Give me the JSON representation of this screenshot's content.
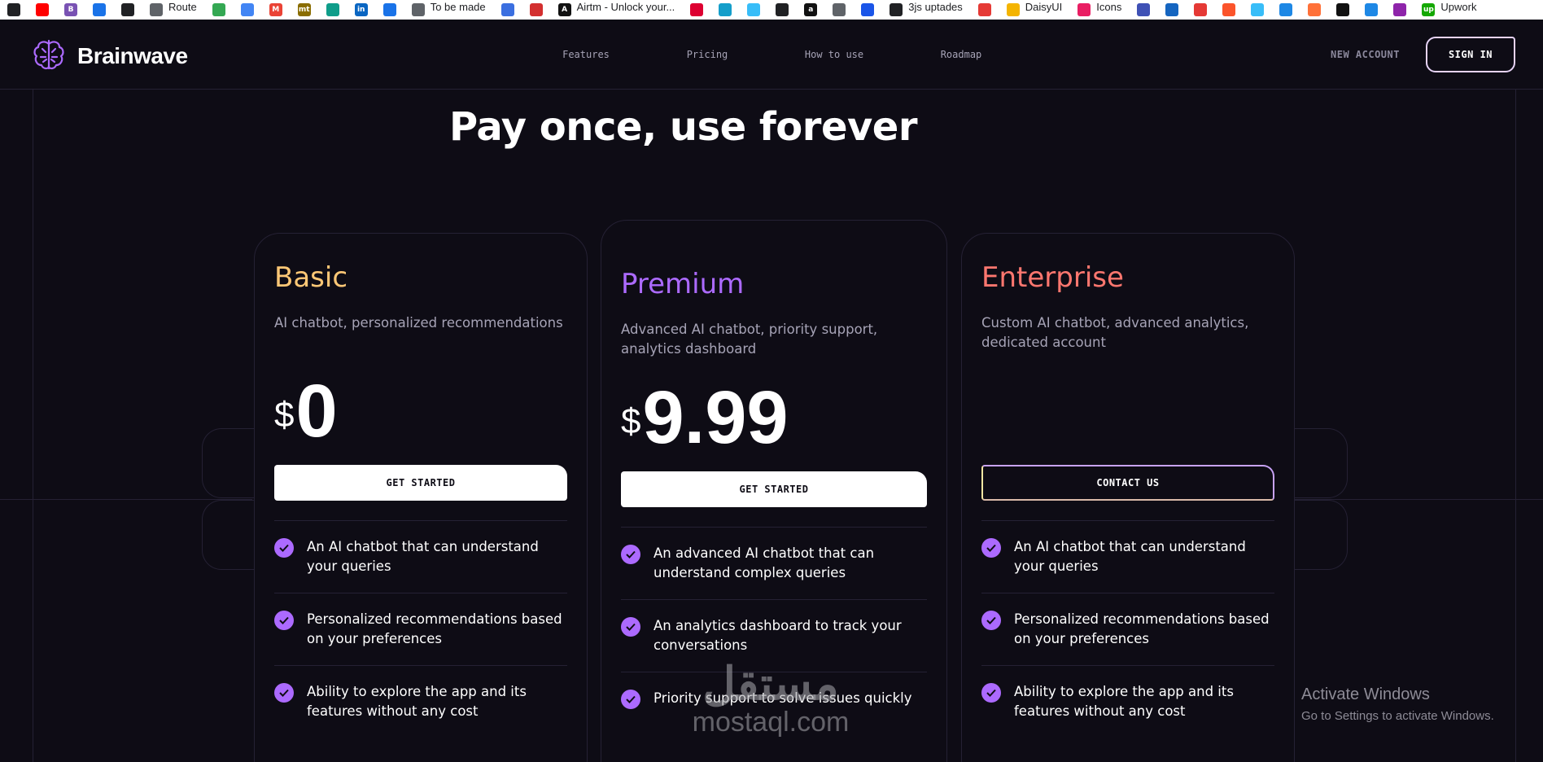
{
  "bookmarks": [
    {
      "icon": "grid-icon",
      "label": "",
      "color": "#202124"
    },
    {
      "icon": "youtube-icon",
      "label": "",
      "color": "#ff0000"
    },
    {
      "icon": "bootstrap-icon",
      "label": "",
      "color": "#7952b3",
      "glyph": "B"
    },
    {
      "icon": "blue-badge-icon",
      "label": "",
      "color": "#1a73e8"
    },
    {
      "icon": "github-icon",
      "label": "",
      "color": "#202124"
    },
    {
      "icon": "folder-icon",
      "label": "Route",
      "color": "#5f6368"
    },
    {
      "icon": "script-icon",
      "label": "",
      "color": "#34a853"
    },
    {
      "icon": "sparkle-icon",
      "label": "",
      "color": "#4285f4"
    },
    {
      "icon": "gmail-icon",
      "label": "",
      "color": "#ea4335",
      "glyph": "M"
    },
    {
      "icon": "mt-icon",
      "label": "",
      "color": "#8a6d00",
      "glyph": "mt"
    },
    {
      "icon": "diamond-icon",
      "label": "",
      "color": "#0f9d8a"
    },
    {
      "icon": "linkedin-icon",
      "label": "",
      "color": "#0a66c2",
      "glyph": "in"
    },
    {
      "icon": "flag-icon",
      "label": "",
      "color": "#1a73e8"
    },
    {
      "icon": "folder-icon",
      "label": "To be made",
      "color": "#5f6368"
    },
    {
      "icon": "app-icon",
      "label": "",
      "color": "#3b6fe0"
    },
    {
      "icon": "red-square-icon",
      "label": "",
      "color": "#d32f2f"
    },
    {
      "icon": "airtm-icon",
      "label": "Airtm - Unlock your...",
      "color": "#111111",
      "glyph": "A"
    },
    {
      "icon": "angular-icon",
      "label": "",
      "color": "#dd0031"
    },
    {
      "icon": "react-icon",
      "label": "",
      "color": "#149eca"
    },
    {
      "icon": "tailwind-icon",
      "label": "",
      "color": "#38bdf8"
    },
    {
      "icon": "circle-icon",
      "label": "",
      "color": "#202124"
    },
    {
      "icon": "amazon-icon",
      "label": "",
      "color": "#111111",
      "glyph": "a"
    },
    {
      "icon": "pen-icon",
      "label": "",
      "color": "#5f6368"
    },
    {
      "icon": "blue-circle-icon",
      "label": "",
      "color": "#1a55e8"
    },
    {
      "icon": "github-icon",
      "label": "3js uptades",
      "color": "#202124"
    },
    {
      "icon": "red-app-icon",
      "label": "",
      "color": "#e53935"
    },
    {
      "icon": "bulb-icon",
      "label": "DaisyUI",
      "color": "#f4b400"
    },
    {
      "icon": "spiral-icon",
      "label": "Icons",
      "color": "#e91e63"
    },
    {
      "icon": "shield-icon",
      "label": "",
      "color": "#3f51b5"
    },
    {
      "icon": "wave-icon",
      "label": "",
      "color": "#1565c0"
    },
    {
      "icon": "code-icon",
      "label": "",
      "color": "#e53935"
    },
    {
      "icon": "brave-icon",
      "label": "",
      "color": "#fb542b"
    },
    {
      "icon": "tailwind-icon",
      "label": "",
      "color": "#38bdf8"
    },
    {
      "icon": "cloud-icon",
      "label": "",
      "color": "#1e88e5"
    },
    {
      "icon": "firefox-icon",
      "label": "",
      "color": "#ff7139"
    },
    {
      "icon": "vercel-icon",
      "label": "",
      "color": "#111111"
    },
    {
      "icon": "ring-icon",
      "label": "",
      "color": "#1e88e5"
    },
    {
      "icon": "purple-app-icon",
      "label": "",
      "color": "#8e24aa"
    },
    {
      "icon": "upwork-icon",
      "label": "Upwork",
      "color": "#14a800",
      "glyph": "up"
    }
  ],
  "header": {
    "brand": "Brainwave",
    "nav": [
      "Features",
      "Pricing",
      "How to use",
      "Roadmap"
    ],
    "new_account": "NEW ACCOUNT",
    "sign_in": "SIGN IN",
    "brand_color": "#ac6aff"
  },
  "title": "Pay once, use forever",
  "plans": [
    {
      "name": "Basic",
      "color": "#ffc876",
      "description": "AI chatbot, personalized recommendations",
      "currency": "$",
      "price": "0",
      "button": "GET STARTED",
      "features": [
        "An AI chatbot that can understand your queries",
        "Personalized recommendations based on your preferences",
        "Ability to explore the app and its features without any cost"
      ]
    },
    {
      "name": "Premium",
      "color": "#ac6aff",
      "description": "Advanced AI chatbot, priority support, analytics dashboard",
      "currency": "$",
      "price": "9.99",
      "button": "GET STARTED",
      "features": [
        "An advanced AI chatbot that can understand complex queries",
        "An analytics dashboard to track your conversations",
        "Priority support to solve issues quickly"
      ]
    },
    {
      "name": "Enterprise",
      "color": "#ff776f",
      "description": "Custom AI chatbot, advanced analytics, dedicated account",
      "button": "CONTACT US",
      "features": [
        "An AI chatbot that can understand your queries",
        "Personalized recommendations based on your preferences",
        "Ability to explore the app and its features without any cost"
      ]
    }
  ],
  "check_color": "#ac6aff",
  "overlay": {
    "activate_title": "Activate Windows",
    "activate_sub": "Go to Settings to activate Windows.",
    "watermark_ar": "مستقل",
    "watermark_url": "mostaql.com"
  }
}
